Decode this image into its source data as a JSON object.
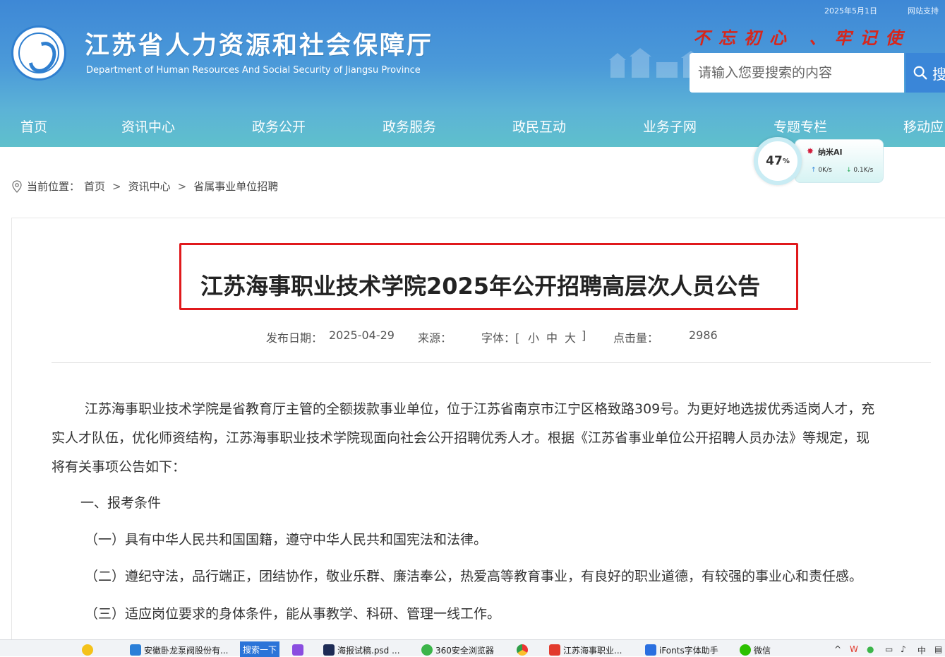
{
  "topbar": {
    "date": "2025年5月1日",
    "support": "网站支持"
  },
  "header": {
    "title": "江苏省人力资源和社会保障厅",
    "subtitle": "Department of Human Resources And Social Security of Jiangsu Province",
    "slogan": "不忘初心 、牢记使",
    "search_placeholder": "请输入您要搜索的内容",
    "search_button": "搜"
  },
  "nav": [
    "首页",
    "资讯中心",
    "政务公开",
    "政务服务",
    "政民互动",
    "业务子网",
    "专题专栏",
    "移动应"
  ],
  "speed_widget": {
    "percent": "47",
    "percent_unit": "%",
    "label": "纳米AI",
    "upload": "0K/s",
    "download": "0.1K/s"
  },
  "breadcrumb": {
    "prefix": "当前位置：",
    "items": [
      "首页",
      "资讯中心",
      "省属事业单位招聘"
    ]
  },
  "article": {
    "title": "江苏海事职业技术学院2025年公开招聘高层次人员公告",
    "meta": {
      "date_label": "发布日期：",
      "date": "2025-04-29",
      "source_label": "来源：",
      "font_label": "字体：[",
      "font_small": "小",
      "font_medium": "中",
      "font_large": "大",
      "font_close": "]",
      "clicks_label": "点击量：",
      "clicks": "2986"
    },
    "paragraphs": [
      "江苏海事职业技术学院是省教育厅主管的全额拨款事业单位，位于江苏省南京市江宁区格致路309号。为更好地选拔优秀适岗人才，充",
      "实人才队伍，优化师资结构，江苏海事职业技术学院现面向社会公开招聘优秀人才。根据《江苏省事业单位公开招聘人员办法》等规定，现",
      "将有关事项公告如下："
    ],
    "section1": "一、报考条件",
    "items": [
      "（一）具有中华人民共和国国籍，遵守中华人民共和国宪法和法律。",
      "（二）遵纪守法，品行端正，团结协作，敬业乐群、廉洁奉公，热爱高等教育事业，有良好的职业道德，有较强的事业心和责任感。",
      "（三）适应岗位要求的身体条件，能从事教学、科研、管理一线工作。"
    ]
  },
  "taskbar": {
    "search_btn": "搜索一下",
    "tasks": [
      "安徽卧龙泵阀股份有...",
      "海报试稿.psd ...",
      "360安全浏览器",
      "江苏海事职业...",
      "iFonts字体助手",
      "微信"
    ]
  },
  "colors": {
    "header_blue": "#3e88d6",
    "title_border_red": "#e0191c",
    "slogan_red": "#d7261b"
  }
}
